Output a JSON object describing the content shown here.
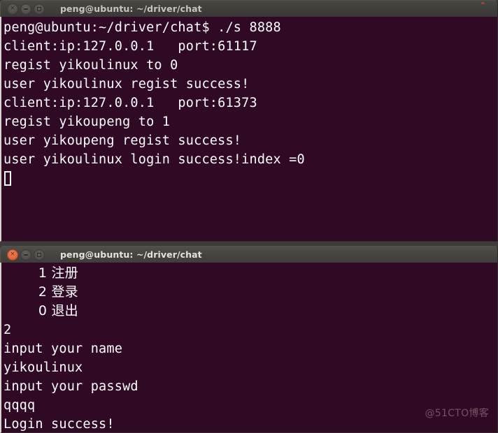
{
  "desktop": {
    "background_color": "#3c3b37"
  },
  "windows": [
    {
      "id": "server-terminal",
      "title": "peng@ubuntu: ~/driver/chat",
      "active": false,
      "controls": {
        "close_label": "×",
        "minimize_label": "–",
        "maximize_label": "□"
      },
      "terminal": {
        "background_color": "#300a24",
        "foreground_color": "#ffffff",
        "lines": [
          "peng@ubuntu:~/driver/chat$ ./s 8888",
          "client:ip:127.0.0.1   port:61117",
          "regist yikoulinux to 0",
          "user yikoulinux regist success!",
          "client:ip:127.0.0.1   port:61373",
          "regist yikoupeng to 1",
          "user yikoupeng regist success!",
          "user yikoulinux login success!index =0"
        ],
        "cursor": "block"
      }
    },
    {
      "id": "client-terminal",
      "title": "peng@ubuntu: ~/driver/chat",
      "active": true,
      "controls": {
        "close_label": "×",
        "minimize_label": "–",
        "maximize_label": "□"
      },
      "terminal": {
        "background_color": "#300a24",
        "foreground_color": "#ffffff",
        "menu": [
          "        1 注册",
          "        2 登录",
          "        0 退出"
        ],
        "lines": [
          "2",
          "input your name",
          "yikoulinux",
          "input your passwd",
          "qqqq",
          "Login success!"
        ]
      }
    }
  ],
  "watermark": {
    "text": "@51CTO博客"
  }
}
